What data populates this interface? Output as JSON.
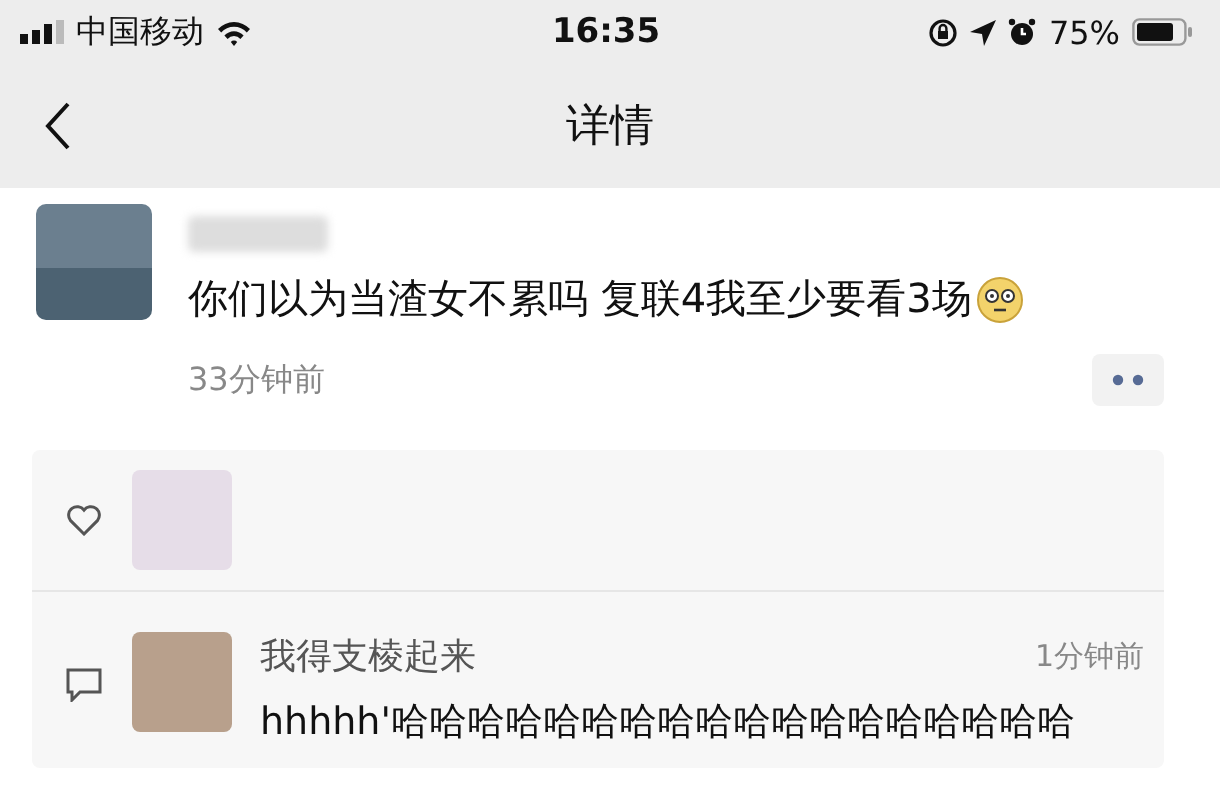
{
  "status_bar": {
    "carrier": "中国移动",
    "time": "16:35",
    "battery": "75%"
  },
  "nav": {
    "title": "详情"
  },
  "post": {
    "text": "你们以为当渣女不累吗 复联4我至少要看3场",
    "time": "33分钟前"
  },
  "comments": [
    {
      "name": "我得支棱起来",
      "time": "1分钟前",
      "text": "hhhhh'哈哈哈哈哈哈哈哈哈哈哈哈哈哈哈哈哈哈"
    }
  ]
}
